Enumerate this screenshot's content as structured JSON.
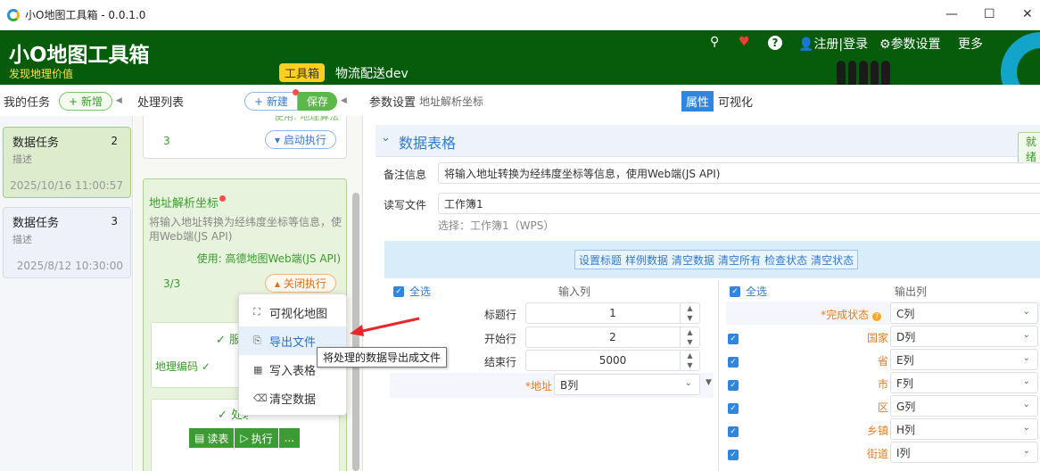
{
  "window": {
    "title": "小O地图工具箱 - 0.0.1.0"
  },
  "header": {
    "brand": "小O地图工具箱",
    "slogan": "发现地理价值",
    "tag": "工具箱",
    "project": "物流配送dev",
    "links": [
      "注册|登录",
      "参数设置",
      "更多"
    ]
  },
  "tasks": {
    "title": "我的任务",
    "add": "新增",
    "items": [
      {
        "name": "数据任务",
        "count": "2",
        "desc": "描述",
        "date": "2025/10/16 11:00:57"
      },
      {
        "name": "数据任务",
        "count": "3",
        "desc": "描述",
        "date": "2025/8/12 10:30:00"
      }
    ]
  },
  "process": {
    "title": "处理列表",
    "new": "新建",
    "save": "保存",
    "card1": {
      "clip": "使用: 地理算法",
      "count": "3",
      "start": "启动执行"
    },
    "card2": {
      "title": "地址解析坐标",
      "desc": "将输入地址转换为经纬度坐标等信息，使用Web端(JS API)",
      "use": "使用: 高德地图Web端(JS API)",
      "count": "3/3",
      "close": "关闭执行"
    },
    "sub1": {
      "title": "服",
      "row": "地理编码"
    },
    "sub2": {
      "title": "处理状态"
    },
    "actions": {
      "read": "读表",
      "run": "执行",
      "more": "..."
    }
  },
  "menu": {
    "items": [
      "可视化地图",
      "导出文件",
      "写入表格",
      "清空数据"
    ],
    "tooltip": "将处理的数据导出成文件"
  },
  "params": {
    "title": "参数设置",
    "subtitle": "地址解析坐标",
    "tab_attr": "属性",
    "tab_vis": "可视化",
    "section": "数据表格",
    "corner": "就绪",
    "note_label": "备注信息",
    "note": "将输入地址转换为经纬度坐标等信息，使用Web端(JS API)",
    "file_label": "读写文件",
    "file": "工作簿1",
    "file_hint": "选择：工作簿1（WPS）",
    "toolbar": [
      "设置标题",
      "样例数据",
      "清空数据",
      "清空所有",
      "检查状态",
      "清空状态"
    ],
    "input": {
      "select_all": "全选",
      "header": "输入列",
      "rows": [
        {
          "label": "标题行",
          "value": "1"
        },
        {
          "label": "开始行",
          "value": "2"
        },
        {
          "label": "结束行",
          "value": "5000"
        }
      ],
      "addr_label": "*地址",
      "addr": "B列"
    },
    "output": {
      "select_all": "全选",
      "header": "输出列",
      "rows": [
        {
          "label": "*完成状态",
          "value": "C列"
        },
        {
          "label": "国家",
          "value": "D列"
        },
        {
          "label": "省",
          "value": "E列"
        },
        {
          "label": "市",
          "value": "F列"
        },
        {
          "label": "区",
          "value": "G列"
        },
        {
          "label": "乡镇",
          "value": "H列"
        },
        {
          "label": "街道",
          "value": "I列"
        }
      ]
    }
  }
}
